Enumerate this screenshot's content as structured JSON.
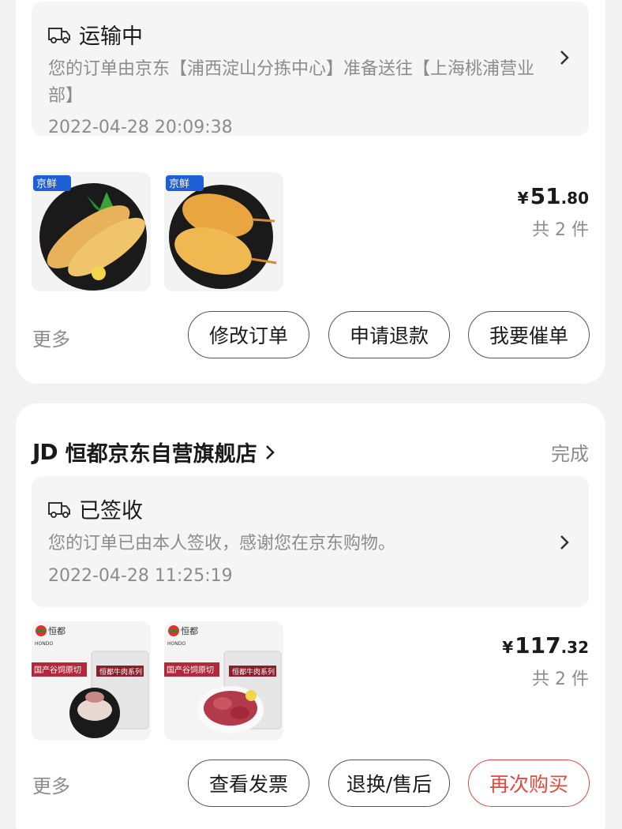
{
  "orders": [
    {
      "status": {
        "icon": "truck-icon",
        "title": "运输中",
        "description": "您的订单由京东【浦西淀山分拣中心】准备送往【上海桃浦营业部】",
        "time": "2022-04-28 20:09:38"
      },
      "products": [
        {
          "name": "fried-fish-fillet",
          "badge": "京鲜"
        },
        {
          "name": "fried-shrimp",
          "badge": "京鲜"
        }
      ],
      "price": {
        "symbol": "¥",
        "integer": "51",
        "cents": ".80"
      },
      "quantity": "共 2 件",
      "more": "更多",
      "buttons": [
        "修改订单",
        "申请退款",
        "我要催单"
      ]
    },
    {
      "shop": {
        "logo": "JD",
        "name": "恒都京东自营旗舰店",
        "status": "完成"
      },
      "status": {
        "icon": "truck-check-icon",
        "title": "已签收",
        "description": "您的订单已由本人签收，感谢您在京东购物。",
        "time": "2022-04-28 11:25:19"
      },
      "products": [
        {
          "brand": "恒都",
          "brand_en": "HONDO",
          "banner": "国产谷饲原切",
          "pack": "恒都牛肉系列"
        },
        {
          "brand": "恒都",
          "brand_en": "HONDO",
          "banner": "国产谷饲原切",
          "pack": "恒都牛肉系列"
        }
      ],
      "price": {
        "symbol": "¥",
        "integer": "117",
        "cents": ".32"
      },
      "quantity": "共 2 件",
      "more": "更多",
      "buttons": [
        "查看发票",
        "退换/售后",
        "再次购买"
      ]
    }
  ],
  "colors": {
    "accent_red": "#e5483c",
    "muted": "#8c8c8c"
  }
}
